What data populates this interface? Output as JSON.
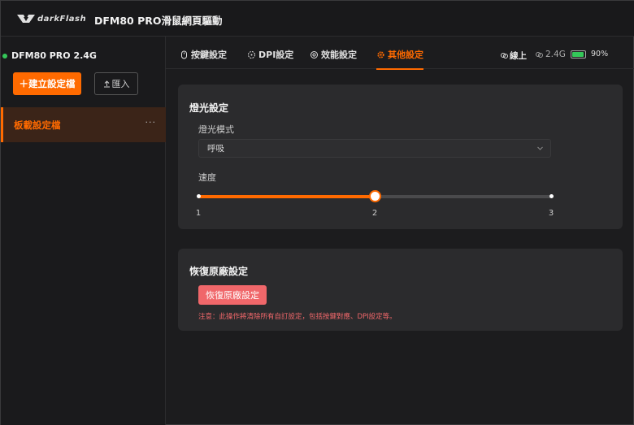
{
  "titlebar": {
    "logo_text": "darkFlash",
    "title": "DFM80 PRO滑鼠網頁驅動"
  },
  "sidebar": {
    "device_name": "DFM80 PRO 2.4G",
    "device_status_color": "#34c759",
    "create_label": "＋建立設定檔",
    "import_label": "匯入",
    "profiles": [
      {
        "label": "板載設定檔",
        "active": true,
        "more": "···"
      }
    ]
  },
  "tabs": [
    {
      "label": "按鍵設定",
      "icon": "mouse-icon",
      "active": false
    },
    {
      "label": "DPI設定",
      "icon": "dpi-icon",
      "active": false
    },
    {
      "label": "效能設定",
      "icon": "performance-icon",
      "active": false
    },
    {
      "label": "其他設定",
      "icon": "gear-icon",
      "active": true
    }
  ],
  "status": {
    "online_label": "線上",
    "connection_label": "2.4G",
    "battery_label": "90%",
    "battery_level": 0.9
  },
  "lighting": {
    "title": "燈光設定",
    "mode_label": "燈光模式",
    "mode_value": "呼吸",
    "speed_label": "速度",
    "speed_ticks": [
      "1",
      "2",
      "3"
    ],
    "speed_value": 2,
    "speed_min": 1,
    "speed_max": 3
  },
  "reset": {
    "title": "恢復原廠設定",
    "button_label": "恢復原廠設定",
    "warning": "注意：此操作將清除所有自訂設定，包括按鍵對應、DPI設定等。"
  },
  "colors": {
    "accent": "#ff6a00",
    "danger": "#f0676a",
    "background": "#1c1c1e",
    "card": "#2b2b2d"
  }
}
